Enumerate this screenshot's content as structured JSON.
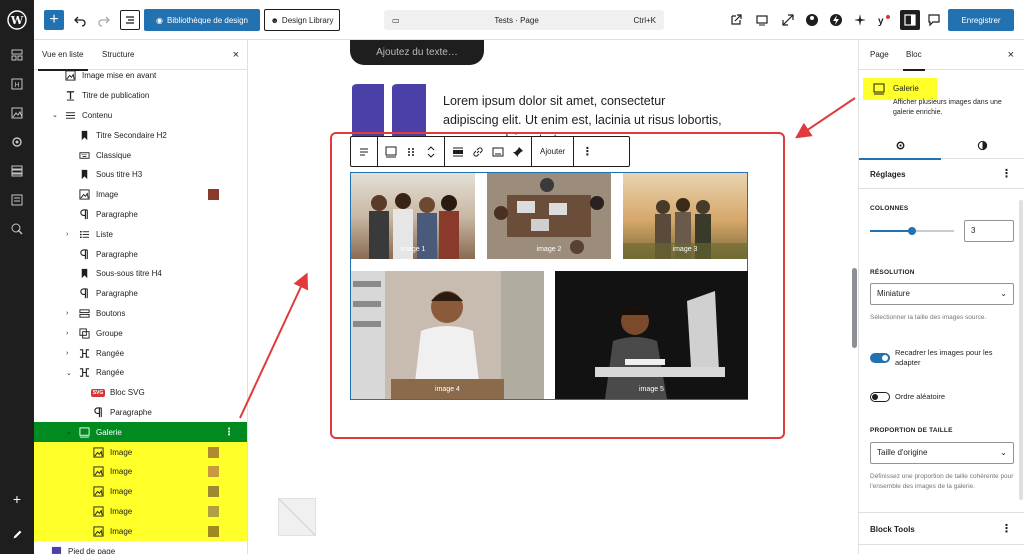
{
  "toolbar": {
    "add_label": "+",
    "biblio_label": "Bibliothèque de design",
    "design_library_label": "Design Library",
    "doc_title": "Tests · Page",
    "shortcut": "Ctrl+K",
    "save_label": "Enregistrer"
  },
  "listview": {
    "tab_list": "Vue en liste",
    "tab_structure": "Structure",
    "close": "×",
    "rows": [
      {
        "label": "Image mise en avant",
        "icon": "image-icon",
        "indent": 1
      },
      {
        "label": "Titre de publication",
        "icon": "title-icon",
        "indent": 1
      },
      {
        "label": "Contenu",
        "icon": "content-icon",
        "indent": 1,
        "expanded": true
      },
      {
        "label": "Titre Secondaire H2",
        "icon": "bookmark-icon",
        "indent": 2
      },
      {
        "label": "Classique",
        "icon": "keyboard-icon",
        "indent": 2
      },
      {
        "label": "Sous titre H3",
        "icon": "bookmark-icon",
        "indent": 2
      },
      {
        "label": "Image",
        "icon": "image-icon",
        "indent": 2,
        "thumb": true
      },
      {
        "label": "Paragraphe",
        "icon": "paragraph-icon",
        "indent": 2
      },
      {
        "label": "Liste",
        "icon": "list-icon",
        "indent": 2,
        "collapsed": true
      },
      {
        "label": "Paragraphe",
        "icon": "paragraph-icon",
        "indent": 2
      },
      {
        "label": "Sous-sous titre H4",
        "icon": "bookmark-icon",
        "indent": 2
      },
      {
        "label": "Paragraphe",
        "icon": "paragraph-icon",
        "indent": 2
      },
      {
        "label": "Boutons",
        "icon": "buttons-icon",
        "indent": 2,
        "collapsed": true
      },
      {
        "label": "Groupe",
        "icon": "group-icon",
        "indent": 2,
        "collapsed": true
      },
      {
        "label": "Rangée",
        "icon": "row-icon",
        "indent": 2,
        "collapsed": true
      },
      {
        "label": "Rangée",
        "icon": "row-icon",
        "indent": 2,
        "expanded": true
      },
      {
        "label": "Bloc SVG",
        "icon": "svg-icon",
        "indent": 3
      },
      {
        "label": "Paragraphe",
        "icon": "paragraph-icon",
        "indent": 3
      },
      {
        "label": "Galerie",
        "icon": "gallery-icon",
        "indent": 2,
        "expanded": true,
        "selected": true
      },
      {
        "label": "Image",
        "icon": "image-icon",
        "indent": 3,
        "thumb": true,
        "hl": true
      },
      {
        "label": "Image",
        "icon": "image-icon",
        "indent": 3,
        "thumb": true,
        "hl": true
      },
      {
        "label": "Image",
        "icon": "image-icon",
        "indent": 3,
        "thumb": true,
        "hl": true
      },
      {
        "label": "Image",
        "icon": "image-icon",
        "indent": 3,
        "thumb": true,
        "hl": true
      },
      {
        "label": "Image",
        "icon": "image-icon",
        "indent": 3,
        "thumb": true,
        "hl": true
      },
      {
        "label": "Pied de page",
        "icon": "footer-icon",
        "indent": 0
      }
    ],
    "svg_badge": "SVG",
    "row_options": "⋮"
  },
  "canvas": {
    "add_text_label": "Ajoutez du texte…",
    "lorem_line1": "Lorem ipsum dolor sit amet, consectetur",
    "lorem_line2": "adipiscing elit. Ut enim est, lacinia ut risus lobortis,",
    "lorem_line3": "posuere pulvinar tortor.",
    "block_toolbar_add": "Ajouter",
    "block_toolbar_more": "⋮",
    "gallery_images": [
      {
        "caption": "image 1"
      },
      {
        "caption": "image 2"
      },
      {
        "caption": "image 3"
      },
      {
        "caption": "image 4"
      },
      {
        "caption": "image 5"
      }
    ]
  },
  "sidebar": {
    "tab_page": "Page",
    "tab_bloc": "Bloc",
    "close": "×",
    "block_title": "Galerie",
    "block_desc": "Afficher plusieurs images dans une galerie enrichie.",
    "section_reglages": "Réglages",
    "kebab": "⋮",
    "columns_label": "COLONNES",
    "columns_value": "3",
    "columns_fraction": 0.5,
    "resolution_label": "RÉSOLUTION",
    "resolution_value": "Miniature",
    "resolution_help": "Sélectionner la taille des images source.",
    "crop_label": "Recadrer les images pour les adapter",
    "crop_on": true,
    "random_label": "Ordre aléatoire",
    "random_on": false,
    "ratio_label": "PROPORTION DE TAILLE",
    "ratio_value": "Taille d'origine",
    "ratio_help": "Définissez une proportion de taille cohérente pour l'ensemble des images de la galerie.",
    "block_tools": "Block Tools"
  },
  "colors": {
    "accent": "#2271b1",
    "highlight": "#ffff29",
    "selected_row": "#008a20",
    "annotation": "#e03a3a",
    "book": "#4b3fa8"
  }
}
